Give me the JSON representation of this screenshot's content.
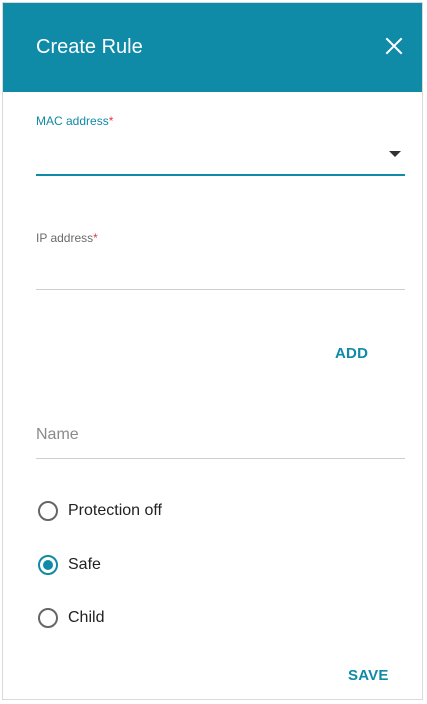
{
  "dialog": {
    "title": "Create Rule",
    "close_icon": "close-icon"
  },
  "mac_field": {
    "label": "MAC address",
    "required_mark": "*",
    "value": ""
  },
  "ip_field": {
    "label": "IP address",
    "required_mark": "*",
    "value": ""
  },
  "add_label": "ADD",
  "name_field": {
    "placeholder": "Name",
    "value": ""
  },
  "protection": {
    "options": [
      "Protection off",
      "Safe",
      "Child"
    ],
    "selected": "Safe"
  },
  "save_label": "SAVE",
  "colors": {
    "accent": "#0f8aa7",
    "required": "#e0383e"
  }
}
